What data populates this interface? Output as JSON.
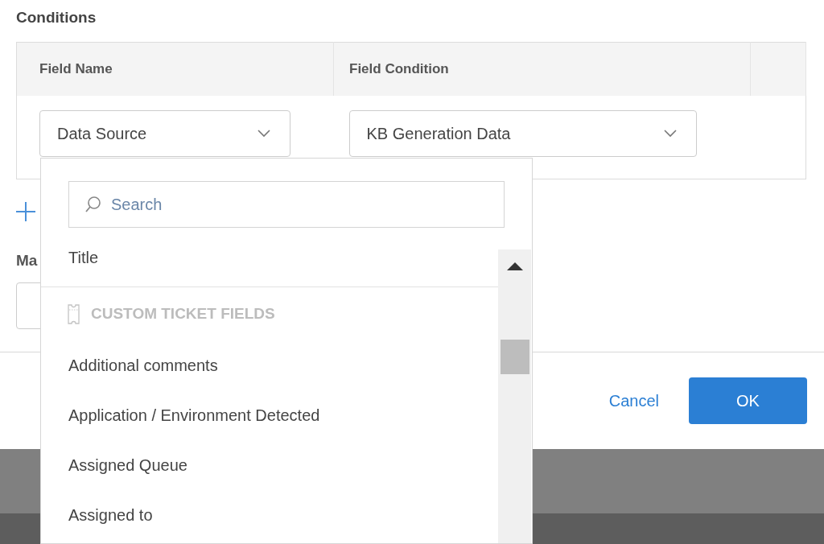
{
  "section_title": "Conditions",
  "table": {
    "columns": [
      "Field Name",
      "Field Condition"
    ],
    "rows": [
      {
        "field_name": "Data Source",
        "field_condition": "KB Generation Data"
      }
    ]
  },
  "second_section_title": "Ma",
  "buttons": [
    {
      "label": "Cancel",
      "kind": "link"
    },
    {
      "label": "OK",
      "kind": "primary"
    }
  ],
  "dropdown": {
    "search_placeholder": "Search",
    "items": [
      {
        "kind": "option",
        "label": "Title"
      },
      {
        "kind": "group",
        "label": "CUSTOM TICKET FIELDS"
      },
      {
        "kind": "option",
        "label": "Additional comments"
      },
      {
        "kind": "option",
        "label": "Application / Environment Detected"
      },
      {
        "kind": "option",
        "label": "Assigned Queue"
      },
      {
        "kind": "option",
        "label": "Assigned to"
      }
    ]
  }
}
